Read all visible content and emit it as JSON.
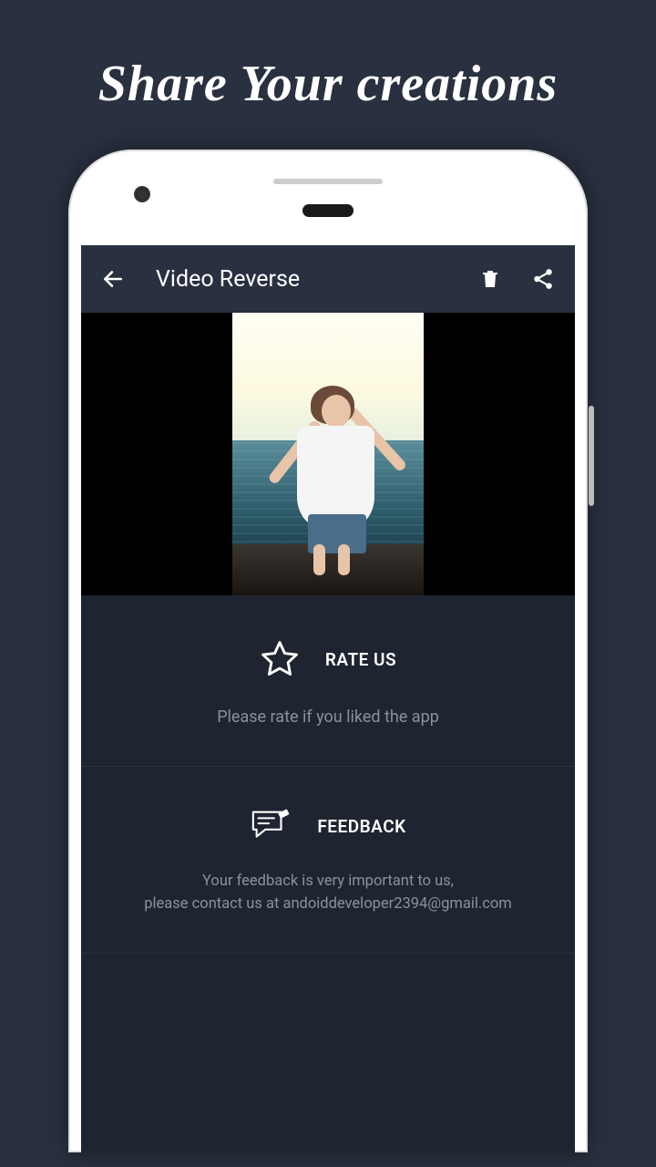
{
  "promo": {
    "title": "Share Your creations"
  },
  "appbar": {
    "title": "Video Reverse",
    "icons": {
      "back": "back-icon",
      "delete": "trash-icon",
      "share": "share-icon"
    }
  },
  "sections": {
    "rate": {
      "title": "RATE US",
      "desc": "Please rate if you liked the app",
      "icon": "star-icon"
    },
    "feedback": {
      "title": "FEEDBACK",
      "desc_line1": "Your feedback is very important to us,",
      "desc_line2": "please contact us at andoiddeveloper2394@gmail.com",
      "icon": "feedback-icon"
    }
  }
}
